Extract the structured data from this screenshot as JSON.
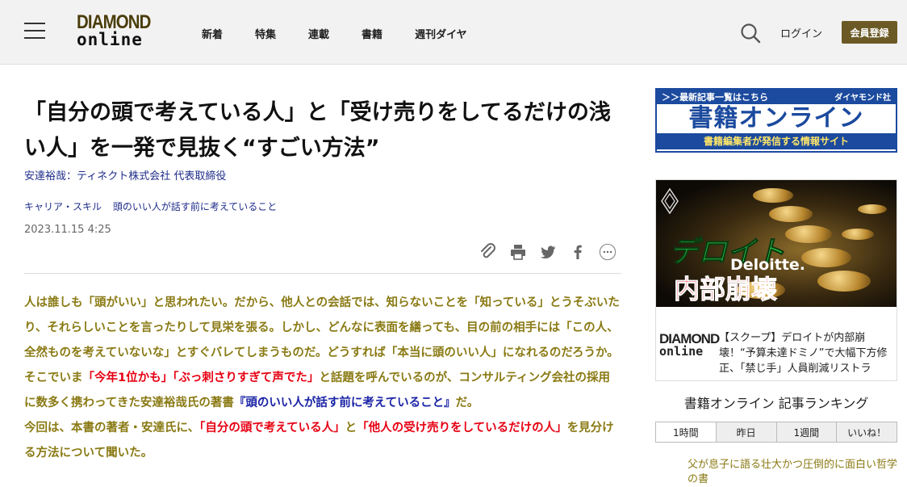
{
  "header": {
    "logo_top": "DIAMOND",
    "logo_bottom": "online",
    "nav": [
      "新着",
      "特集",
      "連載",
      "書籍",
      "週刊ダイヤ"
    ],
    "login": "ログイン",
    "register": "会員登録"
  },
  "article": {
    "title": "「自分の頭で考えている人」と「受け売りをしてるだけの浅い人」を一発で見抜く“すごい方法”",
    "author": "安達裕哉：ティネクト株式会社 代表取締役",
    "tags": [
      "キャリア・スキル",
      "頭のいい人が話す前に考えていること"
    ],
    "date": "2023.11.15 4:25",
    "share_icons": [
      "clip-icon",
      "print-icon",
      "twitter-icon",
      "facebook-icon",
      "more-icon"
    ],
    "p1": "人は誰しも「頭がいい」と思われたい。だから、他人との会話では、知らないことを「知っている」とうそぶいたり、それらしいことを言ったりして見栄を張る。しかし、どんなに表面を繕っても、目の前の相手には「この人、全然ものを考えていないな」とすぐバレてしまうものだ。どうすれば「本当に頭のいい人」になれるのだろうか。",
    "p2_a": "そこでいま",
    "p2_red1": "「今年1位かも」",
    "p2_red2": "「ぶっ刺さりすぎて声でた」",
    "p2_b": "と話題を呼んでいるのが、コンサルティング会社の採用に数多く携わってきた安達裕哉氏の著書",
    "p2_blue": "『頭のいい人が話す前に考えていること』",
    "p2_c": "だ。",
    "p3_a": "今回は、本書の著者・安達氏に、",
    "p3_red1": "「自分の頭で考えている人」",
    "p3_b": "と",
    "p3_red2": "「他人の受け売りをしているだけの人」",
    "p3_c": "を見分ける方法について聞いた。"
  },
  "sidebar": {
    "ad1_top": "＞＞最新記事一覧はこちら",
    "ad1_pub": "ダイヤモンド社",
    "ad1_main": "書籍オンライン",
    "ad1_sub": "書籍編集者が発信する情報サイト",
    "ad2_jp": "デロイト",
    "ad2_en": "Deloitte.",
    "ad2_naibu": "内部崩壊",
    "ad2_logo_top": "DIAMOND",
    "ad2_logo_bottom": "online",
    "ad2_text": "【スクープ】デロイトが内部崩壊！“予算未達ドミノ”で大幅下方修正、「禁じ手」人員削減リストラ",
    "ranking_title": "書籍オンライン 記事ランキング",
    "ranking_tabs": [
      "1時間",
      "昨日",
      "1週間",
      "いいね！"
    ],
    "ranking_item": "父が息子に語る壮大かつ圧倒的に面白い哲学の書"
  }
}
